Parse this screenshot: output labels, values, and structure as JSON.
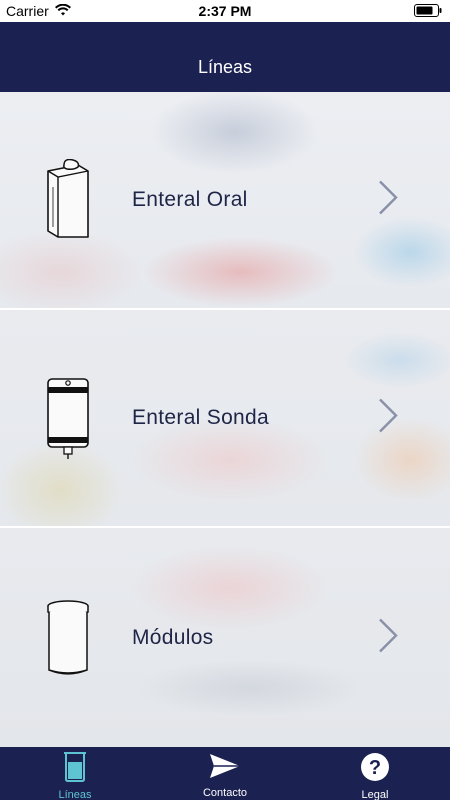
{
  "status_bar": {
    "carrier": "Carrier",
    "time": "2:37 PM"
  },
  "nav": {
    "title": "Líneas"
  },
  "rows": [
    {
      "label": "Enteral Oral",
      "icon": "carton-icon"
    },
    {
      "label": "Enteral Sonda",
      "icon": "feeding-bag-icon"
    },
    {
      "label": "Módulos",
      "icon": "canister-icon"
    }
  ],
  "tabs": [
    {
      "label": "Líneas",
      "icon": "beaker-icon",
      "active": true
    },
    {
      "label": "Contacto",
      "icon": "paper-plane-icon",
      "active": false
    },
    {
      "label": "Legal",
      "icon": "question-icon",
      "active": false
    }
  ],
  "colors": {
    "navy": "#1b2150",
    "accent": "#5fc4d2",
    "text": "#1f2547"
  }
}
